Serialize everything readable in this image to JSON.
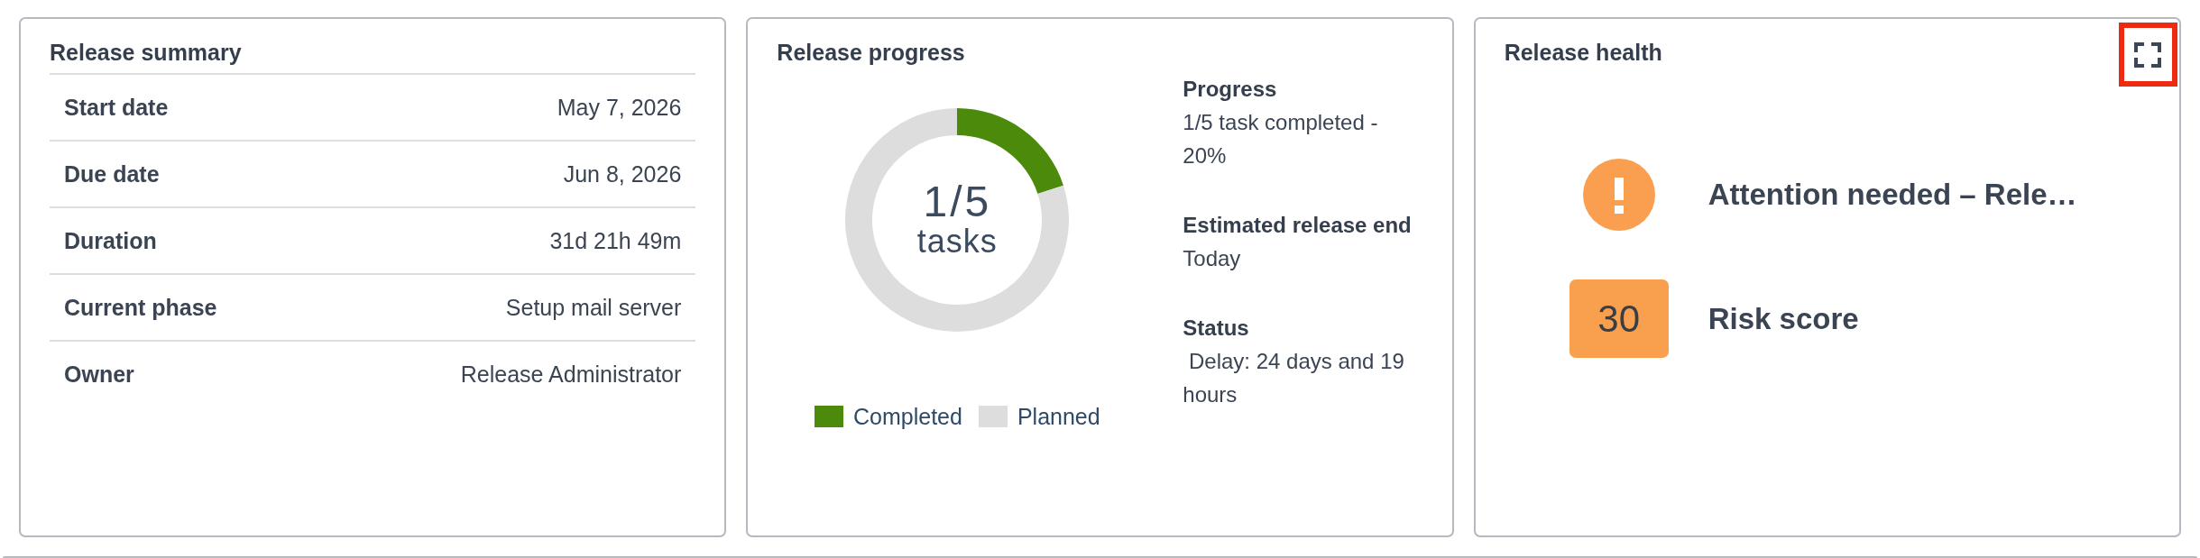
{
  "summary": {
    "title": "Release summary",
    "rows": [
      {
        "label": "Start date",
        "value": "May 7, 2026"
      },
      {
        "label": "Due date",
        "value": "Jun 8, 2026"
      },
      {
        "label": "Duration",
        "value": "31d 21h 49m"
      },
      {
        "label": "Current phase",
        "value": "Setup mail server"
      },
      {
        "label": "Owner",
        "value": "Release Administrator"
      }
    ]
  },
  "progress": {
    "title": "Release progress",
    "chart_data": {
      "type": "donut",
      "categories": [
        "Completed",
        "Planned"
      ],
      "values": [
        20,
        80
      ],
      "colors": [
        "#4b8a0a",
        "#dddddd"
      ]
    },
    "center_value": "1/5",
    "center_label": "tasks",
    "details": [
      {
        "label": "Progress",
        "value": "1/5 task completed - 20%"
      },
      {
        "label": "Estimated release end",
        "value": "Today"
      },
      {
        "label": "Status",
        "value": " Delay: 24 days and 19 hours"
      }
    ]
  },
  "health": {
    "title": "Release health",
    "message": "Attention needed – Rele…",
    "risk_score": "30",
    "risk_label": "Risk score"
  }
}
